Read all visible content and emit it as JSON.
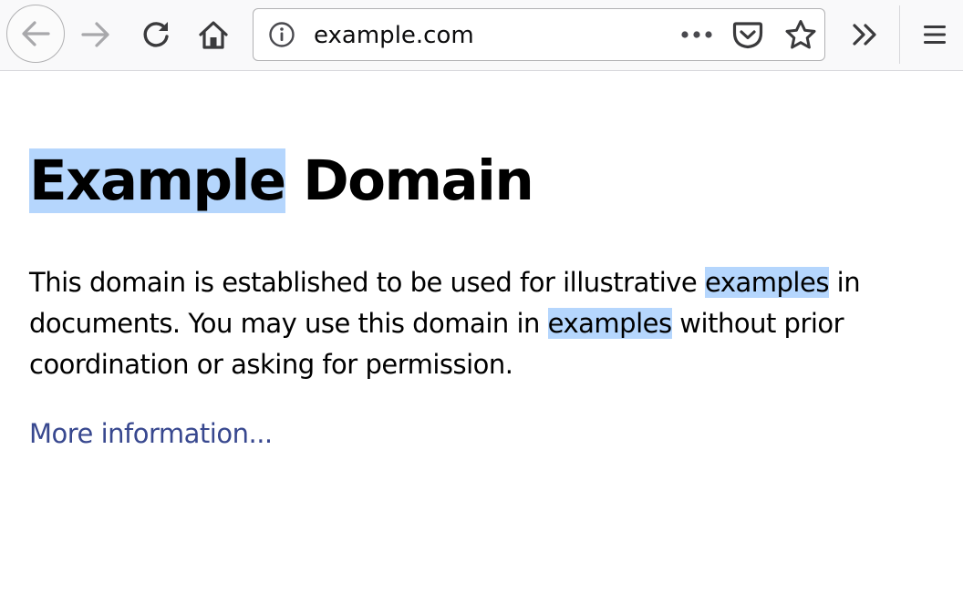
{
  "browser": {
    "toolbar": {
      "back_icon": "arrow-left-icon",
      "forward_icon": "arrow-right-icon",
      "reload_icon": "reload-icon",
      "home_icon": "home-icon",
      "overflow_icon": "chevron-double-right-icon",
      "menu_icon": "hamburger-menu-icon"
    },
    "urlbar": {
      "info_icon": "info-icon",
      "url": "example.com",
      "actions_icon": "more-dots-icon",
      "pocket_icon": "pocket-icon",
      "bookmark_icon": "star-icon"
    },
    "colors": {
      "toolbar_bg": "#f9f9fa",
      "selection_highlight": "#b5d6fd",
      "link": "#38488f"
    }
  },
  "page": {
    "heading": {
      "part1": "Example",
      "part2": " Domain"
    },
    "paragraph": {
      "seg1": "This domain is established to be used for illustrative ",
      "hl1": "examples",
      "seg2": " in documents. You may use this domain in ",
      "hl2": "examples",
      "seg3": " without prior coordination or asking for permission."
    },
    "link_text": "More information..."
  }
}
